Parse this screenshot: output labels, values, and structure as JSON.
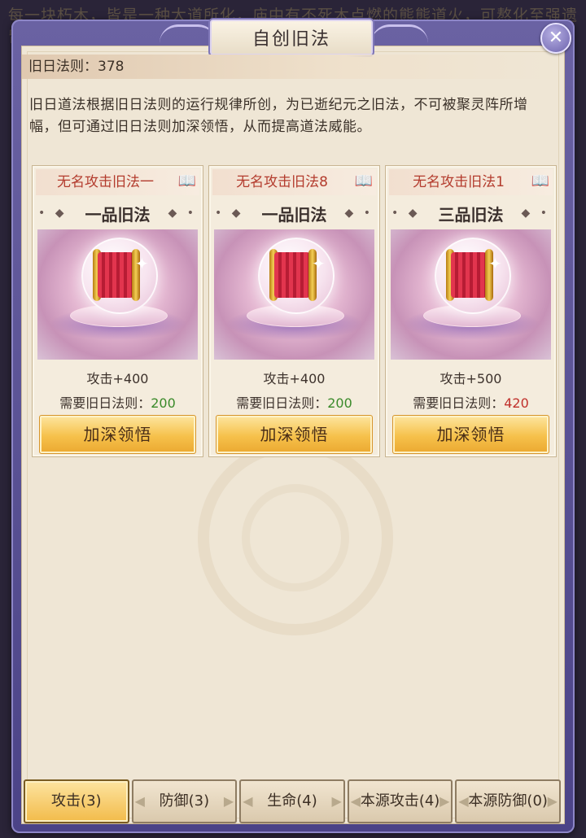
{
  "background_text": "每一块朽木，皆是一种大道所化，庙中有不死木点燃的熊熊道火，可熬化至强遗留的旧日纪元道法……",
  "window": {
    "title": "自创旧法",
    "close_icon": "close-icon"
  },
  "law_points": "旧日法则：378",
  "description": "旧日道法根据旧日法则的运行规律所创，为已逝纪元之旧法，不可被聚灵阵所增幅，但可通过旧日法则加深领悟，从而提高道法威能。",
  "cards": [
    {
      "name": "无名攻击旧法一",
      "grade": "一品旧法",
      "stat": "攻击+400",
      "req_label": "需要旧日法则：",
      "req_value": "200",
      "req_status_color": "#3a8a2a",
      "button": "加深领悟"
    },
    {
      "name": "无名攻击旧法8",
      "grade": "一品旧法",
      "stat": "攻击+400",
      "req_label": "需要旧日法则：",
      "req_value": "200",
      "req_status_color": "#3a8a2a",
      "button": "加深领悟"
    },
    {
      "name": "无名攻击旧法1",
      "grade": "三品旧法",
      "stat": "攻击+500",
      "req_label": "需要旧日法则：",
      "req_value": "420",
      "req_status_color": "#c0302b",
      "button": "加深领悟"
    }
  ],
  "tabs": [
    {
      "label": "攻击(3)",
      "active": true
    },
    {
      "label": "防御(3)",
      "active": false
    },
    {
      "label": "生命(4)",
      "active": false
    },
    {
      "label": "本源攻击(4)",
      "active": false
    },
    {
      "label": "本源防御(0)",
      "active": false
    }
  ],
  "colors": {
    "frame": "#5b539a",
    "panel": "#efe6d5",
    "card_name": "#b33b2d",
    "button": "#f6c14b",
    "req_ok": "#3a8a2a",
    "req_insufficient": "#c0302b"
  }
}
